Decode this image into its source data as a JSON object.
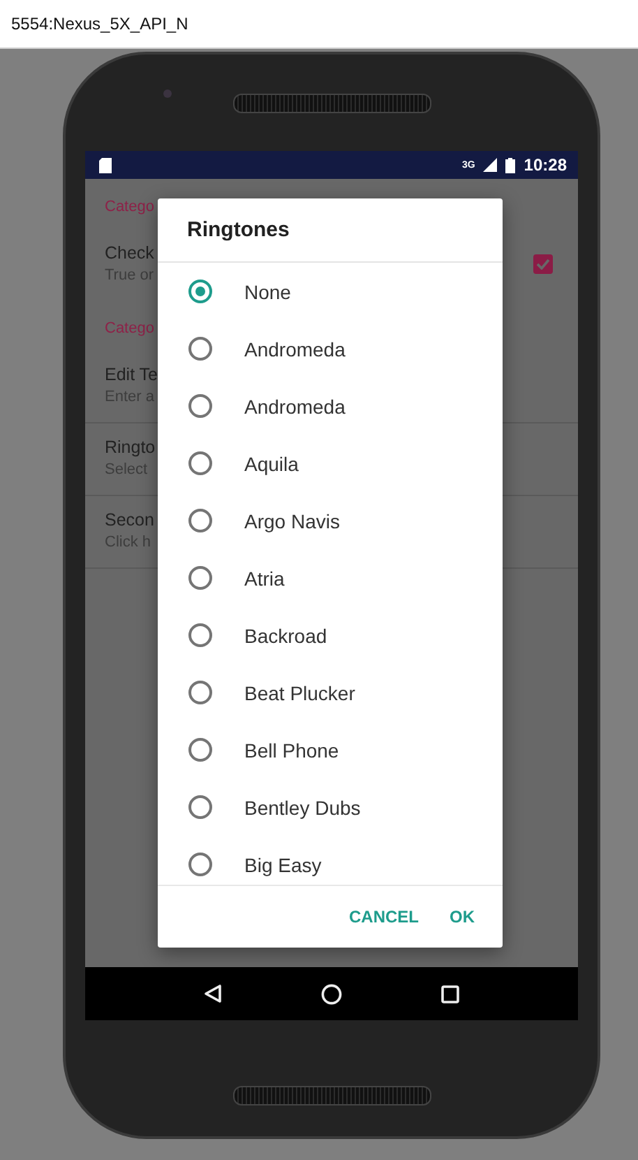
{
  "window": {
    "title": "5554:Nexus_5X_API_N"
  },
  "status_bar": {
    "network": "3G",
    "time": "10:28"
  },
  "preferences": [
    {
      "kind": "category",
      "title": "Catego"
    },
    {
      "kind": "checkbox",
      "title": "Check",
      "summary": "True or",
      "checked": true
    },
    {
      "kind": "category",
      "title": "Catego"
    },
    {
      "kind": "item",
      "title": "Edit Te",
      "summary": "Enter a"
    },
    {
      "kind": "item",
      "title": "Ringto",
      "summary": "Select"
    },
    {
      "kind": "item",
      "title": "Secon",
      "summary": "Click h"
    }
  ],
  "dialog": {
    "title": "Ringtones",
    "options": [
      {
        "label": "None",
        "selected": true
      },
      {
        "label": "Andromeda",
        "selected": false
      },
      {
        "label": "Andromeda",
        "selected": false
      },
      {
        "label": "Aquila",
        "selected": false
      },
      {
        "label": "Argo Navis",
        "selected": false
      },
      {
        "label": "Atria",
        "selected": false
      },
      {
        "label": "Backroad",
        "selected": false
      },
      {
        "label": "Beat Plucker",
        "selected": false
      },
      {
        "label": "Bell Phone",
        "selected": false
      },
      {
        "label": "Bentley Dubs",
        "selected": false
      },
      {
        "label": "Big Easy",
        "selected": false
      }
    ],
    "buttons": [
      "CANCEL",
      "OK"
    ]
  }
}
